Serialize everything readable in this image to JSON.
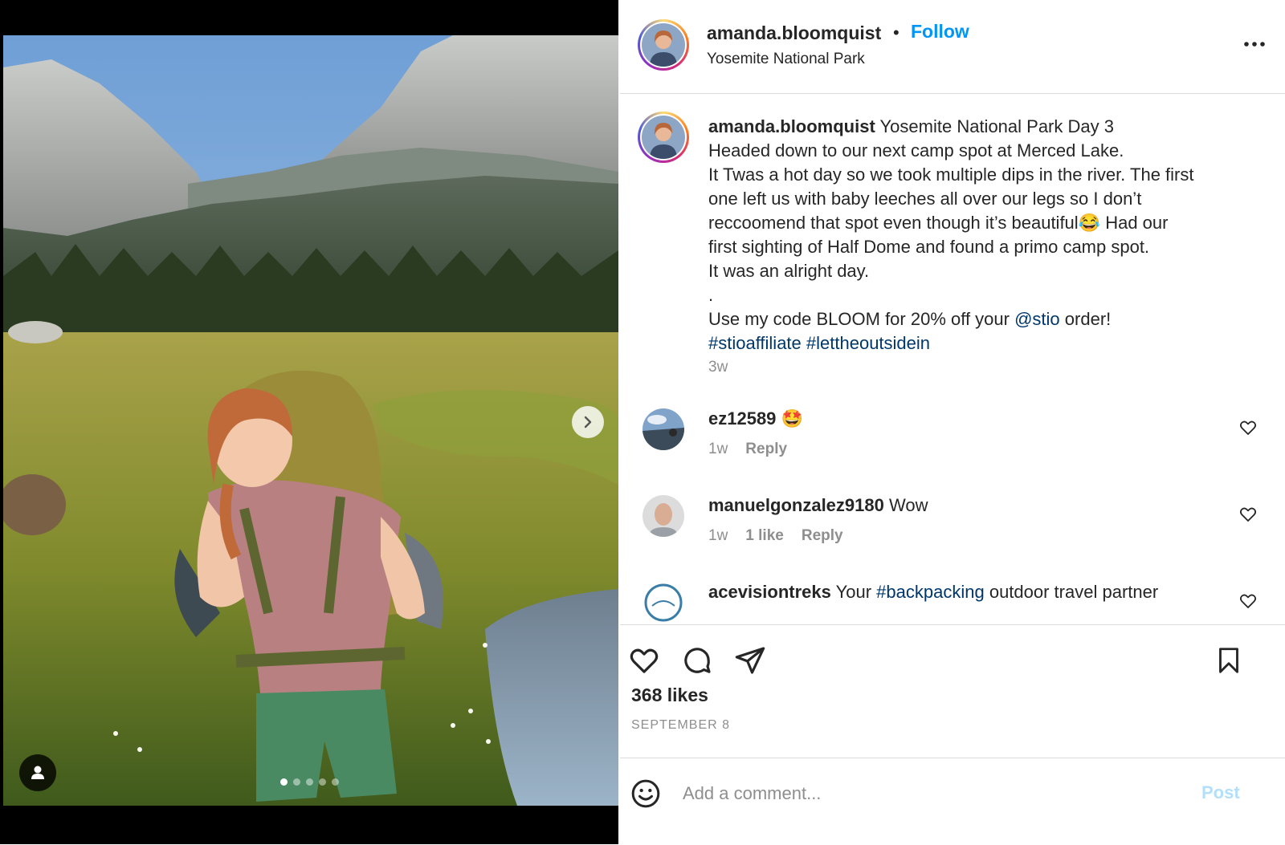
{
  "post": {
    "username": "amanda.bloomquist",
    "separator": "•",
    "follow_label": "Follow",
    "location": "Yosemite National Park",
    "more_icon": "more-horizontal-icon",
    "carousel": {
      "total": 5,
      "active_index": 0
    }
  },
  "caption": {
    "username": "amanda.bloomquist",
    "line1": "Yosemite National Park Day 3",
    "line2": "Headed down to our next camp spot at Merced Lake.",
    "line3": "It Twas a hot day so we took multiple dips in the river. The first",
    "line4": "one left us with baby leeches all over our legs so I don’t",
    "line5a": "reccoomend that spot even though it’s beautiful",
    "line5_emoji": "😂",
    "line5b": " Had our",
    "line6": "first sighting of Half Dome and found a primo camp spot.",
    "line7": "It was an alright day.",
    "line8": ".",
    "line9a": "Use my code BLOOM for 20% off your ",
    "mention": "@stio",
    "line9b": " order!",
    "hashtag1": "#stioaffiliate",
    "hashtag2": "#lettheoutsidein",
    "time": "3w"
  },
  "comments": [
    {
      "username": "ez12589",
      "text": "🤩",
      "time": "1w",
      "likes": "",
      "reply": "Reply"
    },
    {
      "username": "manuelgonzalez9180",
      "text": "Wow",
      "time": "1w",
      "likes": "1 like",
      "reply": "Reply"
    },
    {
      "username": "acevisiontreks",
      "text_a": "Your ",
      "hashtag": "#backpacking",
      "text_b": " outdoor travel partner"
    }
  ],
  "actions": {
    "likes": "368 likes",
    "date": "SEPTEMBER 8"
  },
  "composer": {
    "placeholder": "Add a comment...",
    "post_label": "Post"
  },
  "colors": {
    "accent": "#0095f6",
    "link": "#00376b",
    "muted": "#8e8e8e",
    "post_disabled": "#b2dffc",
    "border": "#dbdbdb"
  }
}
